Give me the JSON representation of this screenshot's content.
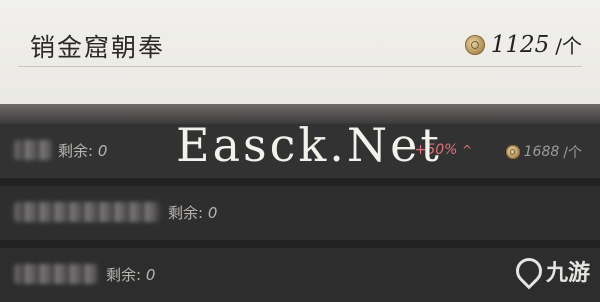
{
  "header": {
    "title": "销金窟朝奉",
    "price_value": "1125",
    "price_unit": "/个",
    "currency_icon": "coin-icon"
  },
  "items": [
    {
      "remain_label": "剩余:",
      "remain_value": "0",
      "rise": "+50%",
      "rise_arrow": "^",
      "price_value": "1688",
      "price_unit": "/个"
    },
    {
      "remain_label": "剩余:",
      "remain_value": "0"
    },
    {
      "remain_label": "剩余:",
      "remain_value": "0"
    }
  ],
  "watermark": "Easck.Net",
  "logo": {
    "text": "九游",
    "icon": "jiuyou-logo-icon"
  },
  "colors": {
    "card_bg": "#efeeea",
    "row_bg": "#333233",
    "rise": "#d9737a",
    "coin": "#a9874d"
  }
}
